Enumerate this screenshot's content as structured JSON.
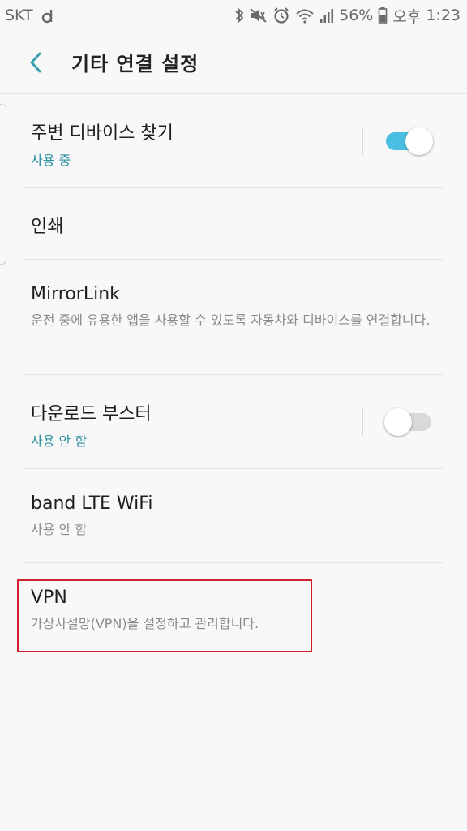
{
  "status_bar": {
    "carrier": "SKT",
    "battery_percent": "56%",
    "period": "오후",
    "time": "1:23",
    "icons": [
      "carrier-d-icon",
      "bluetooth-icon",
      "mute-icon",
      "alarm-icon",
      "wifi-icon",
      "signal-icon",
      "battery-icon"
    ]
  },
  "header": {
    "title": "기타 연결 설정",
    "back_icon": "back-arrow-icon"
  },
  "items": [
    {
      "title": "주변 디바이스 찾기",
      "subtitle": "사용 중",
      "toggle": "on"
    },
    {
      "title": "인쇄"
    },
    {
      "title": "MirrorLink",
      "subtitle": "운전 중에 유용한 앱을 사용할 수 있도록 자동차와 디바이스를 연결합니다."
    },
    {
      "title": "다운로드 부스터",
      "subtitle": "사용 안 함",
      "toggle": "off"
    },
    {
      "title": "band LTE WiFi",
      "subtitle": "사용 안 함"
    },
    {
      "title": "VPN",
      "subtitle": "가상사설망(VPN)을 설정하고 관리합니다."
    }
  ],
  "colors": {
    "accent_teal": "#2a8e9e",
    "toggle_on": "#4bbfe2",
    "highlight_red": "#d0202e"
  }
}
